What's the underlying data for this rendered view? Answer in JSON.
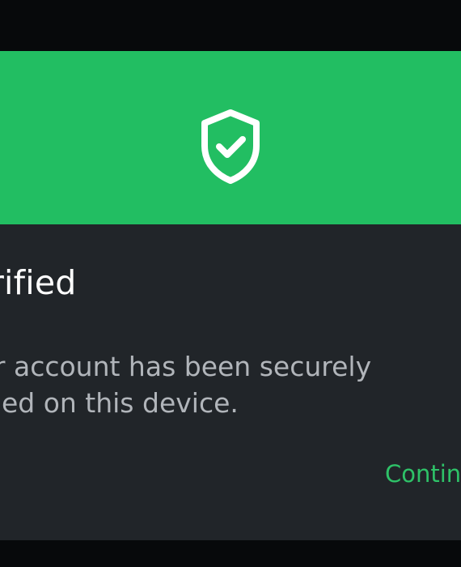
{
  "dialog": {
    "header_icon": "shield-check-icon",
    "title": "rified",
    "body": "ur account has been securely\nified on this device.",
    "continue_label": "Contin"
  },
  "colors": {
    "header_green": "#22be62",
    "dialog_background": "#212529",
    "screen_background": "#07090b",
    "title_text": "#ffffff",
    "body_text": "#b1b5ba",
    "accent_green": "#2ec268"
  }
}
